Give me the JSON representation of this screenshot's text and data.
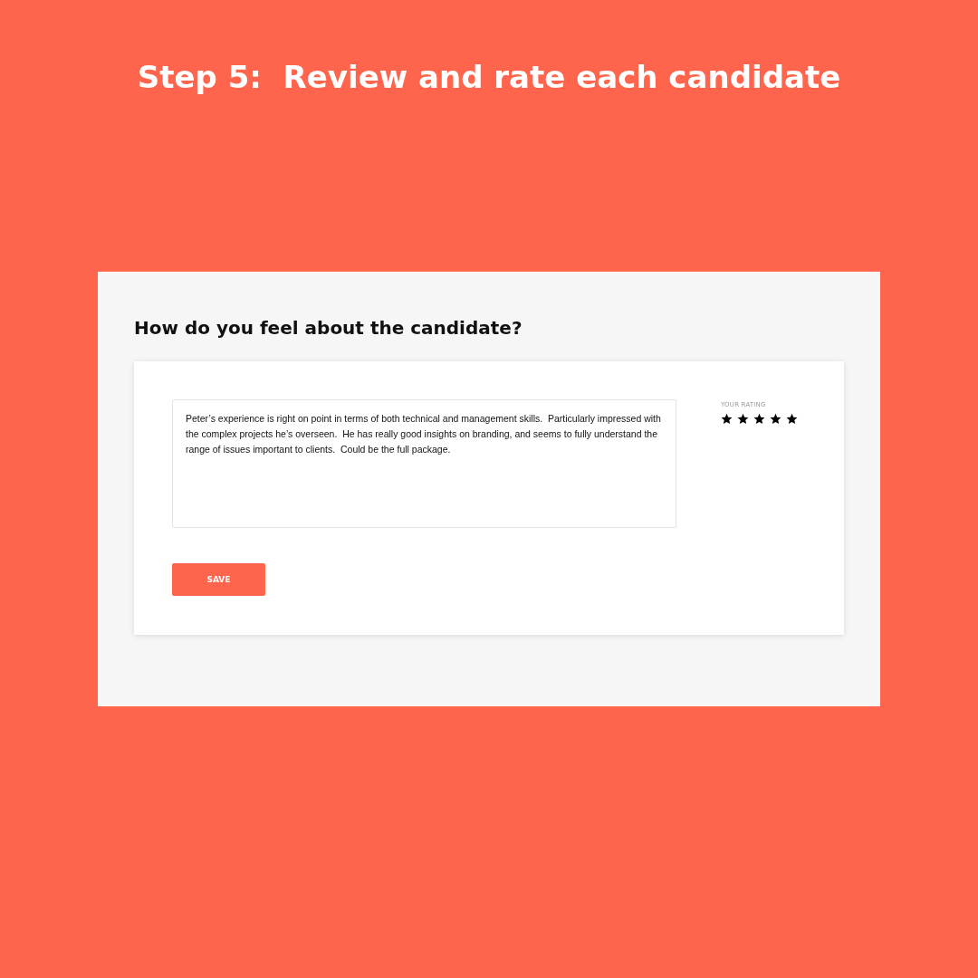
{
  "headline": "Step 5:  Review and rate each candidate",
  "panel": {
    "heading": "How do you feel about the candidate?",
    "review": {
      "value": "Peter’s experience is right on point in terms of both technical and management skills.  Particularly impressed with the complex projects he’s overseen.  He has really good insights on branding, and seems to fully understand the range of issues important to clients.  Could be the full package."
    },
    "rating": {
      "label": "YOUR RATING",
      "stars": 5
    },
    "save_button": "SAVE"
  }
}
